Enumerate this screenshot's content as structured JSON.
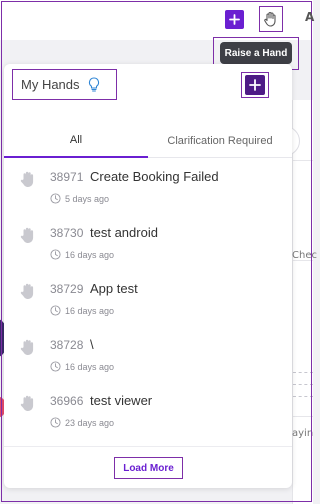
{
  "toolbar": {
    "tooltip": "Raise a Hand",
    "right_cut_letter": "A"
  },
  "panel": {
    "title": "My Hands",
    "tabs": [
      {
        "label": "All",
        "active": true
      },
      {
        "label": "Clarification Required",
        "active": false
      }
    ],
    "items": [
      {
        "id": "38971",
        "title": "Create Booking Failed",
        "time": "5 days ago"
      },
      {
        "id": "38730",
        "title": "test android",
        "time": "16 days ago"
      },
      {
        "id": "38729",
        "title": "App test",
        "time": "16 days ago"
      },
      {
        "id": "38728",
        "title": "\\",
        "time": "16 days ago"
      },
      {
        "id": "36966",
        "title": "test viewer",
        "time": "23 days ago"
      }
    ],
    "load_more": "Load More"
  },
  "background": {
    "right_snippet_1": "Chec",
    "right_snippet_2": "ayin"
  },
  "colors": {
    "accent": "#6a1fd1",
    "accent_dark": "#4e1b86",
    "outline": "#7d2ea8",
    "tooltip_bg": "#3e3f46"
  },
  "icons": {
    "add": "plus-icon",
    "raise_hand": "hand-icon",
    "bulb": "lightbulb-icon",
    "clock": "clock-icon"
  }
}
